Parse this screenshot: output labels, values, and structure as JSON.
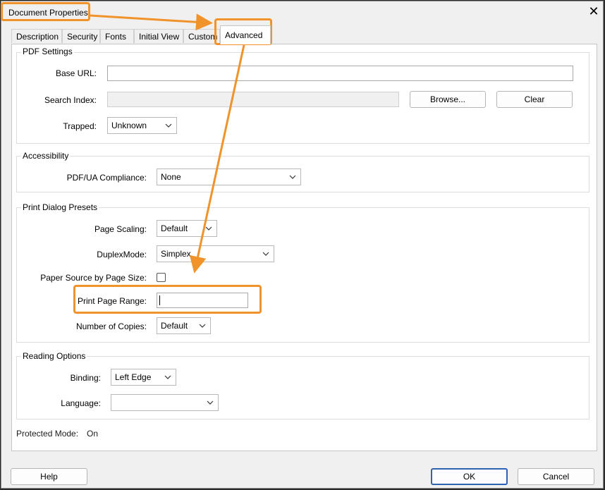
{
  "window": {
    "title": "Document Properties",
    "close_icon": "close-icon"
  },
  "tabs": [
    {
      "label": "Description"
    },
    {
      "label": "Security"
    },
    {
      "label": "Fonts"
    },
    {
      "label": "Initial View"
    },
    {
      "label": "Custom"
    },
    {
      "label": "Advanced",
      "active": true
    }
  ],
  "pdf_settings": {
    "title": "PDF Settings",
    "base_url_label": "Base URL:",
    "base_url_value": "",
    "search_index_label": "Search Index:",
    "search_index_value": "",
    "browse_label": "Browse...",
    "clear_label": "Clear",
    "trapped_label": "Trapped:",
    "trapped_value": "Unknown"
  },
  "accessibility": {
    "title": "Accessibility",
    "pdfua_label": "PDF/UA Compliance:",
    "pdfua_value": "None"
  },
  "print_presets": {
    "title": "Print Dialog Presets",
    "page_scaling_label": "Page Scaling:",
    "page_scaling_value": "Default",
    "duplex_label": "DuplexMode:",
    "duplex_value": "Simplex",
    "paper_source_label": "Paper Source by Page Size:",
    "paper_source_checked": false,
    "print_range_label": "Print Page Range:",
    "print_range_value": "",
    "copies_label": "Number of Copies:",
    "copies_value": "Default"
  },
  "reading_options": {
    "title": "Reading Options",
    "binding_label": "Binding:",
    "binding_value": "Left Edge",
    "language_label": "Language:",
    "language_value": ""
  },
  "protected_mode": {
    "label": "Protected Mode:",
    "value": "On"
  },
  "footer": {
    "help_label": "Help",
    "ok_label": "OK",
    "cancel_label": "Cancel"
  },
  "colors": {
    "annotation": "#f0932b",
    "focus_border": "#2a64b0"
  }
}
